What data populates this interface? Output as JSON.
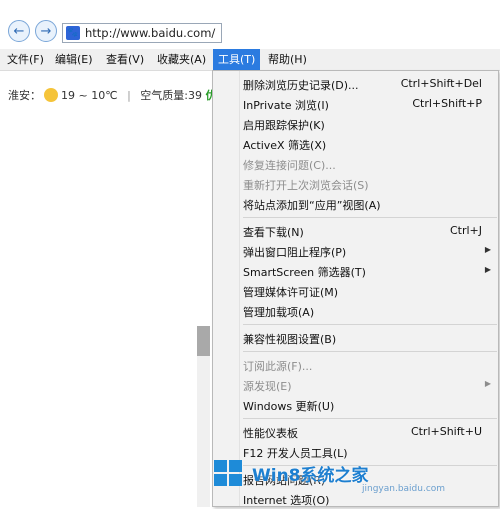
{
  "address_bar": {
    "url": "http://www.baidu.com/",
    "favicon": "paw-icon"
  },
  "menubar": [
    {
      "label": "文件(F)",
      "active": false
    },
    {
      "label": "编辑(E)",
      "active": false
    },
    {
      "label": "查看(V)",
      "active": false
    },
    {
      "label": "收藏夹(A)",
      "active": false
    },
    {
      "label": "工具(T)",
      "active": true
    },
    {
      "label": "帮助(H)",
      "active": false
    }
  ],
  "weather": {
    "city": "淮安：",
    "temp": "19 ~ 10℃",
    "divider": "|",
    "aq_label": "空气质量:39",
    "aq_level": "优"
  },
  "tools_menu": {
    "groups": [
      [
        {
          "label": "删除浏览历史记录(D)...",
          "shortcut": "Ctrl+Shift+Del",
          "disabled": false,
          "submenu": false
        },
        {
          "label": "InPrivate 浏览(I)",
          "shortcut": "Ctrl+Shift+P",
          "disabled": false,
          "submenu": false
        },
        {
          "label": "启用跟踪保护(K)",
          "shortcut": "",
          "disabled": false,
          "submenu": false
        },
        {
          "label": "ActiveX 筛选(X)",
          "shortcut": "",
          "disabled": false,
          "submenu": false
        },
        {
          "label": "修复连接问题(C)...",
          "shortcut": "",
          "disabled": true,
          "submenu": false
        },
        {
          "label": "重新打开上次浏览会话(S)",
          "shortcut": "",
          "disabled": true,
          "submenu": false
        },
        {
          "label": "将站点添加到“应用”视图(A)",
          "shortcut": "",
          "disabled": false,
          "submenu": false
        }
      ],
      [
        {
          "label": "查看下载(N)",
          "shortcut": "Ctrl+J",
          "disabled": false,
          "submenu": false
        },
        {
          "label": "弹出窗口阻止程序(P)",
          "shortcut": "",
          "disabled": false,
          "submenu": true
        },
        {
          "label": "SmartScreen 筛选器(T)",
          "shortcut": "",
          "disabled": false,
          "submenu": true
        },
        {
          "label": "管理媒体许可证(M)",
          "shortcut": "",
          "disabled": false,
          "submenu": false
        },
        {
          "label": "管理加载项(A)",
          "shortcut": "",
          "disabled": false,
          "submenu": false
        }
      ],
      [
        {
          "label": "兼容性视图设置(B)",
          "shortcut": "",
          "disabled": false,
          "submenu": false
        }
      ],
      [
        {
          "label": "订阅此源(F)...",
          "shortcut": "",
          "disabled": true,
          "submenu": false
        },
        {
          "label": "源发现(E)",
          "shortcut": "",
          "disabled": true,
          "submenu": true
        },
        {
          "label": "Windows 更新(U)",
          "shortcut": "",
          "disabled": false,
          "submenu": false
        }
      ],
      [
        {
          "label": "性能仪表板",
          "shortcut": "Ctrl+Shift+U",
          "disabled": false,
          "submenu": false
        },
        {
          "label": "F12 开发人员工具(L)",
          "shortcut": "",
          "disabled": false,
          "submenu": false
        }
      ],
      [
        {
          "label": "报告网站问题(R)",
          "shortcut": "",
          "disabled": false,
          "submenu": false
        },
        {
          "label": "Internet 选项(O)",
          "shortcut": "",
          "disabled": false,
          "submenu": false
        }
      ]
    ]
  },
  "watermark": {
    "text": "Win8系统之家",
    "url": "jingyan.baidu.com"
  },
  "colors": {
    "menu_highlight": "#2b7be0",
    "menu_bg": "#f2f2f2",
    "disabled_text": "#8d8d8d",
    "watermark": "#1d7fd0"
  }
}
